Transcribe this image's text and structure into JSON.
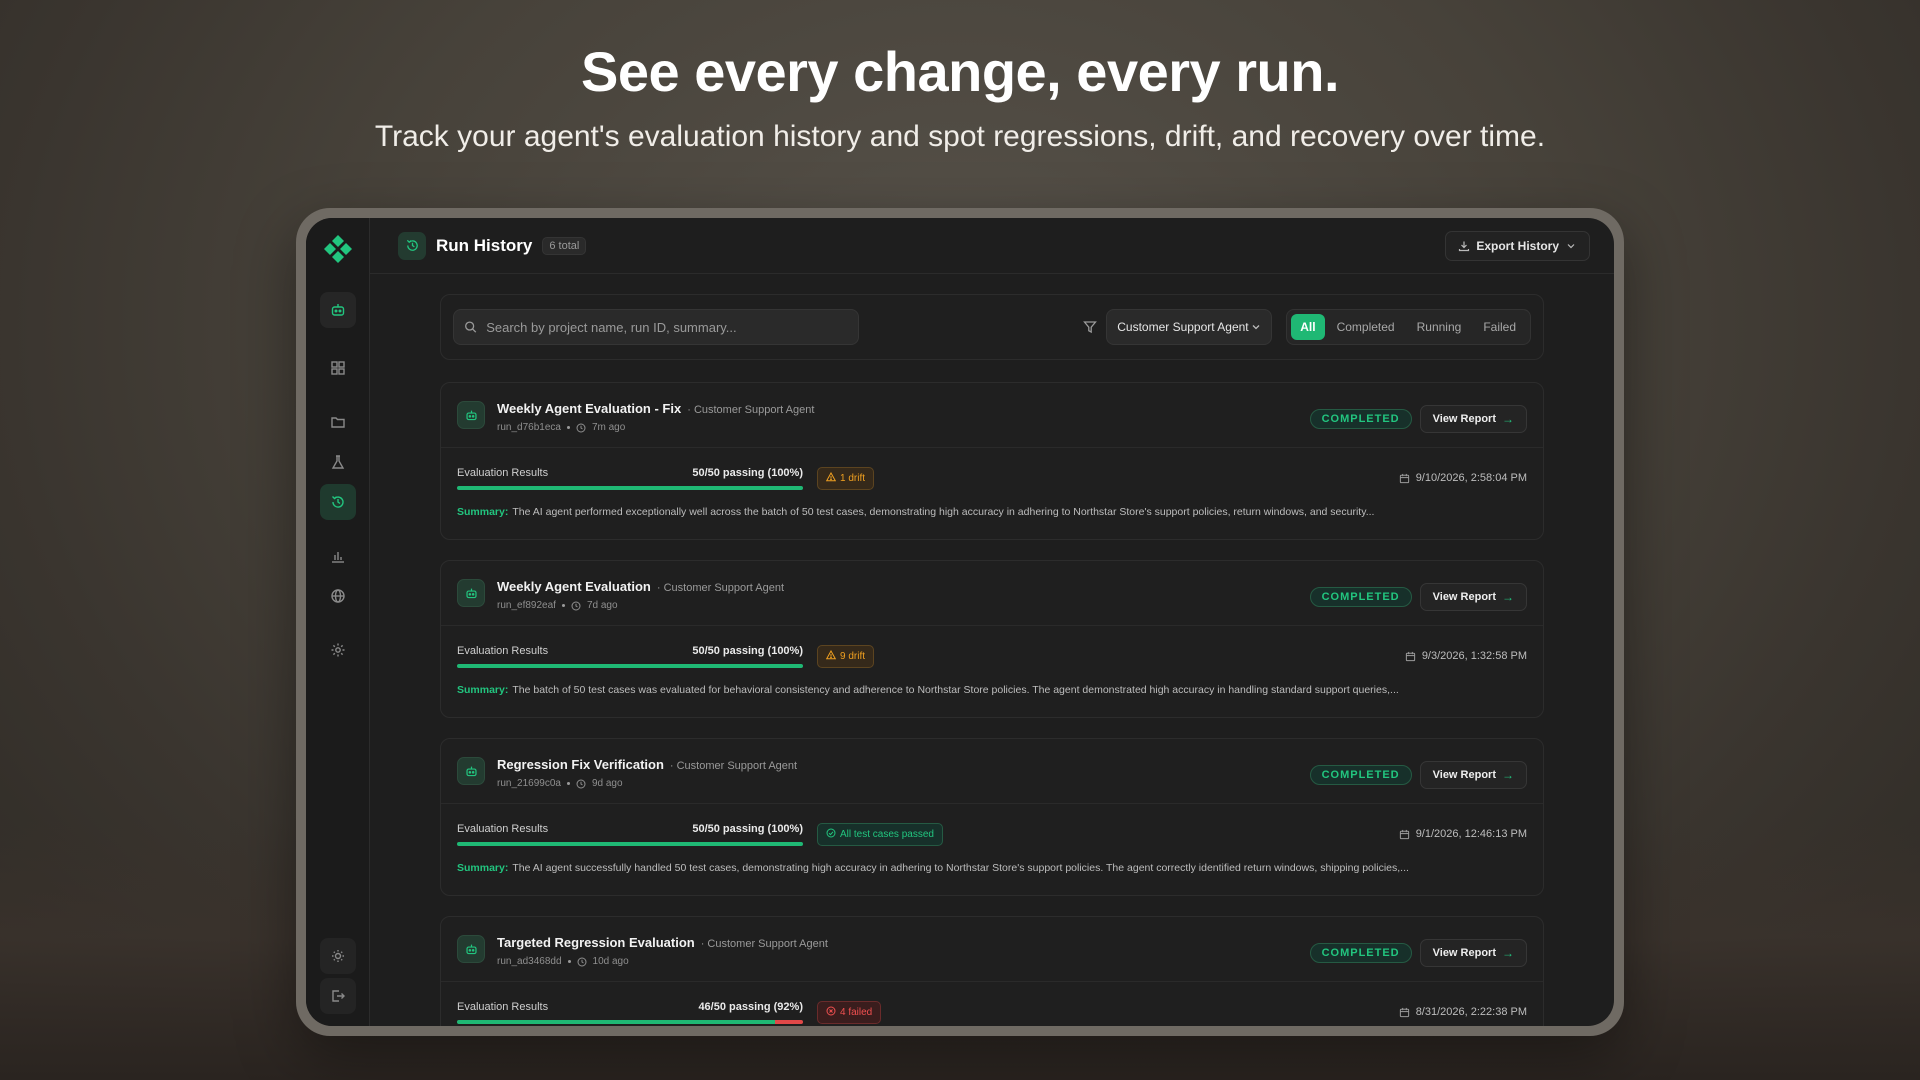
{
  "hero": {
    "title": "See every change, every run.",
    "subtitle": "Track your agent's evaluation history and spot regressions, drift, and recovery over time."
  },
  "sidebar": {
    "items": [
      {
        "name": "agent",
        "icon": "robot-icon"
      },
      {
        "name": "dashboard",
        "icon": "grid-icon"
      },
      {
        "name": "projects",
        "icon": "folder-icon"
      },
      {
        "name": "experiments",
        "icon": "flask-icon"
      },
      {
        "name": "history",
        "icon": "history-icon",
        "active": true
      },
      {
        "name": "analytics",
        "icon": "bar-chart-icon"
      },
      {
        "name": "web",
        "icon": "globe-icon"
      },
      {
        "name": "settings",
        "icon": "gear-icon"
      }
    ],
    "bottom": [
      {
        "name": "theme",
        "icon": "sun-icon"
      },
      {
        "name": "logout",
        "icon": "logout-icon"
      }
    ]
  },
  "header": {
    "title": "Run History",
    "total": "6 total",
    "export_label": "Export History"
  },
  "filters": {
    "search_placeholder": "Search by project name, run ID, summary...",
    "agent_select": "Customer Support Agent",
    "tabs": [
      {
        "label": "All",
        "active": true
      },
      {
        "label": "Completed",
        "active": false
      },
      {
        "label": "Running",
        "active": false
      },
      {
        "label": "Failed",
        "active": false
      }
    ]
  },
  "accent_color": "#1fb874",
  "runs": [
    {
      "title": "Weekly Agent Evaluation - Fix",
      "agent": "· Customer Support Agent",
      "run_id": "run_d76b1eca",
      "age": "7m ago",
      "status": "COMPLETED",
      "view_label": "View Report",
      "eval_label": "Evaluation Results",
      "eval_value": "50/50 passing (100%)",
      "pass_fraction": 1.0,
      "tag": "1 drift",
      "tag_type": "warn",
      "date": "9/10/2026, 2:58:04 PM",
      "summary_label": "Summary:",
      "summary": "The AI agent performed exceptionally well across the batch of 50 test cases, demonstrating high accuracy in adhering to Northstar Store's support policies, return windows, and security..."
    },
    {
      "title": "Weekly Agent Evaluation",
      "agent": "· Customer Support Agent",
      "run_id": "run_ef892eaf",
      "age": "7d ago",
      "status": "COMPLETED",
      "view_label": "View Report",
      "eval_label": "Evaluation Results",
      "eval_value": "50/50 passing (100%)",
      "pass_fraction": 1.0,
      "tag": "9 drift",
      "tag_type": "warn",
      "date": "9/3/2026, 1:32:58 PM",
      "summary_label": "Summary:",
      "summary": "The batch of 50 test cases was evaluated for behavioral consistency and adherence to Northstar Store policies. The agent demonstrated high accuracy in handling standard support queries,..."
    },
    {
      "title": "Regression Fix Verification",
      "agent": "· Customer Support Agent",
      "run_id": "run_21699c0a",
      "age": "9d ago",
      "status": "COMPLETED",
      "view_label": "View Report",
      "eval_label": "Evaluation Results",
      "eval_value": "50/50 passing (100%)",
      "pass_fraction": 1.0,
      "tag": "All test cases passed",
      "tag_type": "pass",
      "date": "9/1/2026, 12:46:13 PM",
      "summary_label": "Summary:",
      "summary": "The AI agent successfully handled 50 test cases, demonstrating high accuracy in adhering to Northstar Store's support policies. The agent correctly identified return windows, shipping policies,..."
    },
    {
      "title": "Targeted Regression Evaluation",
      "agent": "· Customer Support Agent",
      "run_id": "run_ad3468dd",
      "age": "10d ago",
      "status": "COMPLETED",
      "view_label": "View Report",
      "eval_label": "Evaluation Results",
      "eval_value": "46/50 passing (92%)",
      "pass_fraction": 0.92,
      "tag": "4 failed",
      "tag_type": "fail",
      "date": "8/31/2026, 2:22:38 PM",
      "summary_label": "",
      "summary": ""
    }
  ]
}
